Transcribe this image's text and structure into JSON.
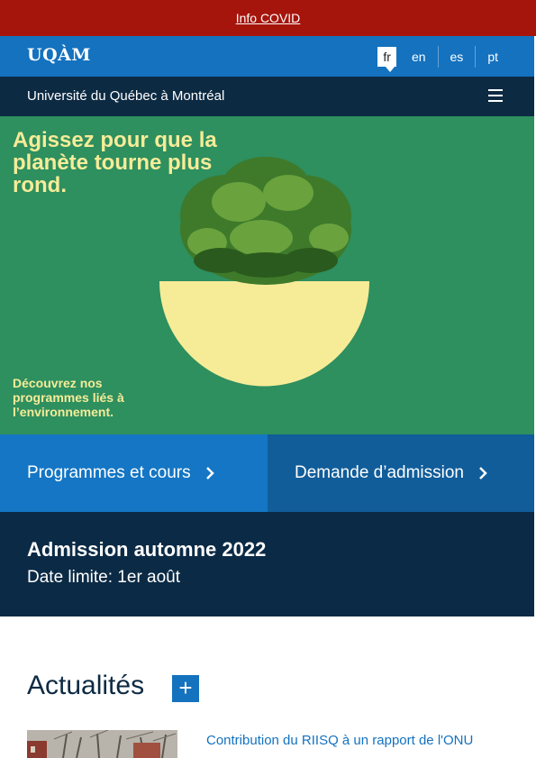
{
  "covid_bar": {
    "link": "Info COVID"
  },
  "header": {
    "logo": "UQÀM",
    "languages": [
      "fr",
      "en",
      "es",
      "pt"
    ],
    "active_language": "fr",
    "university_name": "Université du Québec à Montréal"
  },
  "hero": {
    "title": "Agissez pour que la planète tourne plus rond.",
    "subtitle": "Découvrez nos programmes liés à l’environnement."
  },
  "cta": {
    "programs": "Programmes et cours",
    "admission_request": "Demande d’admission"
  },
  "admission": {
    "title": "Admission automne 2022",
    "deadline": "Date limite: 1er août"
  },
  "news": {
    "heading": "Actualités",
    "plus_symbol": "+",
    "items": [
      {
        "title": "Contribution du RIISQ à un rapport de l'ONU"
      }
    ]
  },
  "colors": {
    "covid_red": "#a6150c",
    "uqam_blue": "#1472bf",
    "navy": "#0d2a43",
    "hero_green": "#2e8f5f",
    "hero_yellow": "#f6ec98"
  }
}
